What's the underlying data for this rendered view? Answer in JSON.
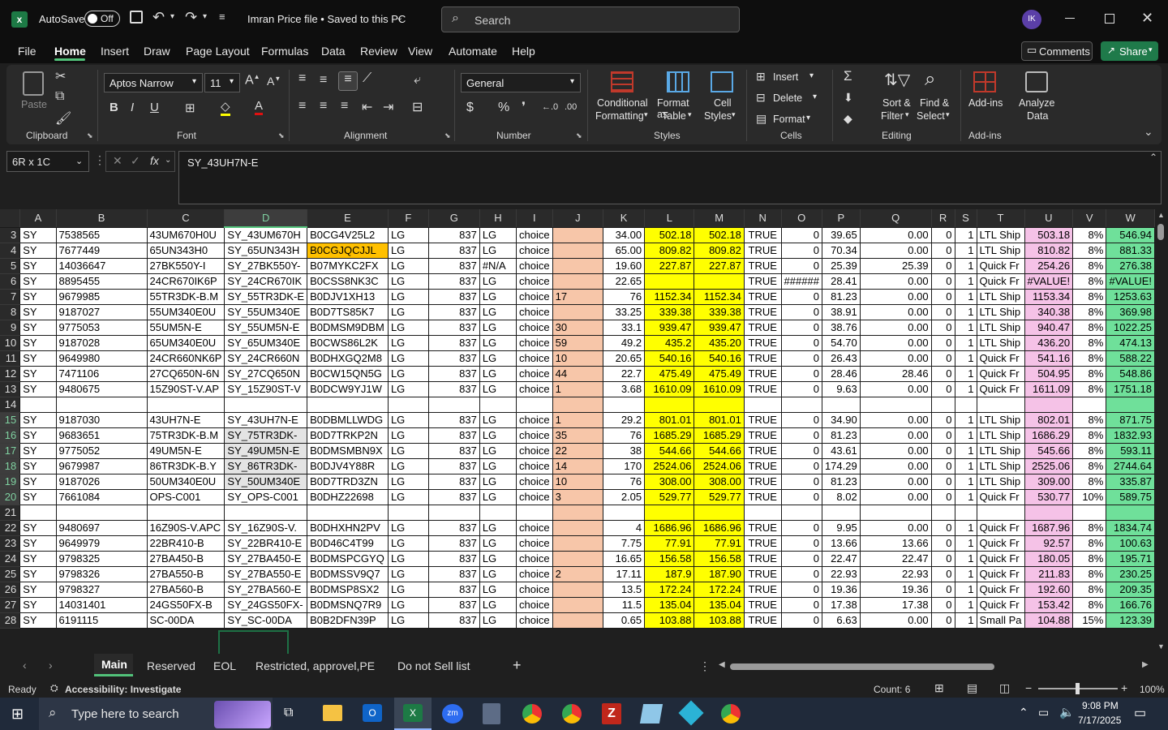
{
  "app": {
    "autosave_label": "AutoSave",
    "autosave_state": "Off",
    "doc_title": "Imran Price file • Saved to this PC",
    "search_placeholder": "Search",
    "avatar_initials": "IK"
  },
  "menu": [
    "File",
    "Home",
    "Insert",
    "Draw",
    "Page Layout",
    "Formulas",
    "Data",
    "Review",
    "View",
    "Automate",
    "Help"
  ],
  "top_buttons": {
    "comments": "Comments",
    "share": "Share"
  },
  "ribbon": {
    "clipboard": {
      "paste": "Paste",
      "group": "Clipboard"
    },
    "font": {
      "name": "Aptos Narrow",
      "size": "11",
      "group": "Font"
    },
    "alignment": {
      "group": "Alignment"
    },
    "number": {
      "format": "General",
      "group": "Number"
    },
    "styles": {
      "conditional": [
        "Conditional",
        "Formatting"
      ],
      "format_table": [
        "Format as",
        "Table"
      ],
      "cell_styles": [
        "Cell",
        "Styles"
      ],
      "group": "Styles"
    },
    "cells": {
      "insert": "Insert",
      "delete": "Delete",
      "format": "Format",
      "group": "Cells"
    },
    "editing": {
      "sort": [
        "Sort &",
        "Filter"
      ],
      "find": [
        "Find &",
        "Select"
      ],
      "group": "Editing"
    },
    "addins": {
      "addins": "Add-ins",
      "analyze": [
        "Analyze",
        "Data"
      ],
      "group": "Add-ins"
    }
  },
  "formula_bar": {
    "name_box": "6R x 1C",
    "content": "SY_43UH7N-E"
  },
  "columns": [
    "A",
    "B",
    "C",
    "D",
    "E",
    "F",
    "G",
    "H",
    "I",
    "J",
    "K",
    "L",
    "M",
    "N",
    "O",
    "P",
    "Q",
    "R",
    "S",
    "T",
    "U",
    "V",
    "W"
  ],
  "rows": [
    {
      "n": "3",
      "c": [
        "SY",
        "7538565",
        "43UM670H0U",
        "SY_43UM670H",
        "B0CG4V25L2",
        "LG",
        "837",
        "LG",
        "choice",
        "",
        "34.00",
        "502.18",
        "502.18",
        "TRUE",
        "0",
        "39.65",
        "0.00",
        "0",
        "1",
        "LTL Ship",
        "503.18",
        "8%",
        "546.94"
      ]
    },
    {
      "n": "4",
      "c": [
        "SY",
        "7677449",
        "65UN343H0",
        "SY_65UN343H",
        "B0CGJQCJJL",
        "LG",
        "837",
        "LG",
        "choice",
        "",
        "65.00",
        "809.82",
        "809.82",
        "TRUE",
        "0",
        "70.34",
        "0.00",
        "0",
        "1",
        "LTL Ship",
        "810.82",
        "8%",
        "881.33"
      ]
    },
    {
      "n": "5",
      "c": [
        "SY",
        "14036647",
        "27BK550Y-I",
        "SY_27BK550Y-",
        "B07MYKC2FX",
        "LG",
        "837",
        "#N/A",
        "choice",
        "",
        "19.60",
        "227.87",
        "227.87",
        "TRUE",
        "0",
        "25.39",
        "25.39",
        "0",
        "1",
        "Quick Fr",
        "254.26",
        "8%",
        "276.38"
      ]
    },
    {
      "n": "6",
      "c": [
        "SY",
        "8895455",
        "24CR670IK6P",
        "SY_24CR670IK",
        "B0CSS8NK3C",
        "LG",
        "837",
        "LG",
        "choice",
        "",
        "22.65",
        "",
        "",
        "TRUE",
        "######",
        "28.41",
        "0.00",
        "0",
        "1",
        "Quick Fr",
        "#VALUE!",
        "8%",
        "#VALUE!"
      ]
    },
    {
      "n": "7",
      "c": [
        "SY",
        "9679985",
        "55TR3DK-B.M",
        "SY_55TR3DK-E",
        "B0DJV1XH13",
        "LG",
        "837",
        "LG",
        "choice",
        "17",
        "76",
        "1152.34",
        "1152.34",
        "TRUE",
        "0",
        "81.23",
        "0.00",
        "0",
        "1",
        "LTL Ship",
        "1153.34",
        "8%",
        "1253.63"
      ]
    },
    {
      "n": "8",
      "c": [
        "SY",
        "9187027",
        "55UM340E0U",
        "SY_55UM340E",
        "B0D7TS85K7",
        "LG",
        "837",
        "LG",
        "choice",
        "",
        "33.25",
        "339.38",
        "339.38",
        "TRUE",
        "0",
        "38.91",
        "0.00",
        "0",
        "1",
        "LTL Ship",
        "340.38",
        "8%",
        "369.98"
      ]
    },
    {
      "n": "9",
      "c": [
        "SY",
        "9775053",
        "55UM5N-E",
        "SY_55UM5N-E",
        "B0DMSM9DBM",
        "LG",
        "837",
        "LG",
        "choice",
        "30",
        "33.1",
        "939.47",
        "939.47",
        "TRUE",
        "0",
        "38.76",
        "0.00",
        "0",
        "1",
        "LTL Ship",
        "940.47",
        "8%",
        "1022.25"
      ]
    },
    {
      "n": "10",
      "c": [
        "SY",
        "9187028",
        "65UM340E0U",
        "SY_65UM340E",
        "B0CWS86L2K",
        "LG",
        "837",
        "LG",
        "choice",
        "59",
        "49.2",
        "435.2",
        "435.20",
        "TRUE",
        "0",
        "54.70",
        "0.00",
        "0",
        "1",
        "LTL Ship",
        "436.20",
        "8%",
        "474.13"
      ]
    },
    {
      "n": "11",
      "c": [
        "SY",
        "9649980",
        "24CR660NK6P",
        "SY_24CR660N",
        "B0DHXGQ2M8",
        "LG",
        "837",
        "LG",
        "choice",
        "10",
        "20.65",
        "540.16",
        "540.16",
        "TRUE",
        "0",
        "26.43",
        "0.00",
        "0",
        "1",
        "Quick Fr",
        "541.16",
        "8%",
        "588.22"
      ]
    },
    {
      "n": "12",
      "c": [
        "SY",
        "7471106",
        "27CQ650N-6N",
        "SY_27CQ650N",
        "B0CW15QN5G",
        "LG",
        "837",
        "LG",
        "choice",
        "44",
        "22.7",
        "475.49",
        "475.49",
        "TRUE",
        "0",
        "28.46",
        "28.46",
        "0",
        "1",
        "Quick Fr",
        "504.95",
        "8%",
        "548.86"
      ]
    },
    {
      "n": "13",
      "c": [
        "SY",
        "9480675",
        "15Z90ST-V.AP",
        "SY_15Z90ST-V",
        "B0DCW9YJ1W",
        "LG",
        "837",
        "LG",
        "choice",
        "1",
        "3.68",
        "1610.09",
        "1610.09",
        "TRUE",
        "0",
        "9.63",
        "0.00",
        "0",
        "1",
        "Quick Fr",
        "1611.09",
        "8%",
        "1751.18"
      ]
    },
    {
      "n": "14",
      "c": [
        "",
        "",
        "",
        "",
        "",
        "",
        "",
        "",
        "",
        "",
        "",
        "",
        "",
        "",
        "",
        "",
        "",
        "",
        "",
        "",
        "",
        "",
        ""
      ]
    },
    {
      "n": "15",
      "c": [
        "SY",
        "9187030",
        "43UH7N-E",
        "SY_43UH7N-E",
        "B0DBMLLWDG",
        "LG",
        "837",
        "LG",
        "choice",
        "1",
        "29.2",
        "801.01",
        "801.01",
        "TRUE",
        "0",
        "34.90",
        "0.00",
        "0",
        "1",
        "LTL Ship",
        "802.01",
        "8%",
        "871.75"
      ]
    },
    {
      "n": "16",
      "c": [
        "SY",
        "9683651",
        "75TR3DK-B.M",
        "SY_75TR3DK-",
        "B0D7TRKP2N",
        "LG",
        "837",
        "LG",
        "choice",
        "35",
        "76",
        "1685.29",
        "1685.29",
        "TRUE",
        "0",
        "81.23",
        "0.00",
        "0",
        "1",
        "LTL Ship",
        "1686.29",
        "8%",
        "1832.93"
      ]
    },
    {
      "n": "17",
      "c": [
        "SY",
        "9775052",
        "49UM5N-E",
        "SY_49UM5N-E",
        "B0DMSMBN9X",
        "LG",
        "837",
        "LG",
        "choice",
        "22",
        "38",
        "544.66",
        "544.66",
        "TRUE",
        "0",
        "43.61",
        "0.00",
        "0",
        "1",
        "LTL Ship",
        "545.66",
        "8%",
        "593.11"
      ]
    },
    {
      "n": "18",
      "c": [
        "SY",
        "9679987",
        "86TR3DK-B.Y",
        "SY_86TR3DK-",
        "B0DJV4Y88R",
        "LG",
        "837",
        "LG",
        "choice",
        "14",
        "170",
        "2524.06",
        "2524.06",
        "TRUE",
        "0",
        "174.29",
        "0.00",
        "0",
        "1",
        "LTL Ship",
        "2525.06",
        "8%",
        "2744.64"
      ]
    },
    {
      "n": "19",
      "c": [
        "SY",
        "9187026",
        "50UM340E0U",
        "SY_50UM340E",
        "B0D7TRD3ZN",
        "LG",
        "837",
        "LG",
        "choice",
        "10",
        "76",
        "308.00",
        "308.00",
        "TRUE",
        "0",
        "81.23",
        "0.00",
        "0",
        "1",
        "LTL Ship",
        "309.00",
        "8%",
        "335.87"
      ]
    },
    {
      "n": "20",
      "c": [
        "SY",
        "7661084",
        "OPS-C001",
        "SY_OPS-C001",
        "B0DHZ22698",
        "LG",
        "837",
        "LG",
        "choice",
        "3",
        "2.05",
        "529.77",
        "529.77",
        "TRUE",
        "0",
        "8.02",
        "0.00",
        "0",
        "1",
        "Quick Fr",
        "530.77",
        "10%",
        "589.75"
      ]
    },
    {
      "n": "21",
      "c": [
        "",
        "",
        "",
        "",
        "",
        "",
        "",
        "",
        "",
        "",
        "",
        "",
        "",
        "",
        "",
        "",
        "",
        "",
        "",
        "",
        "",
        "",
        ""
      ]
    },
    {
      "n": "22",
      "c": [
        "SY",
        "9480697",
        "16Z90S-V.APC",
        "SY_16Z90S-V.",
        "B0DHXHN2PV",
        "LG",
        "837",
        "LG",
        "choice",
        "",
        "4",
        "1686.96",
        "1686.96",
        "TRUE",
        "0",
        "9.95",
        "0.00",
        "0",
        "1",
        "Quick Fr",
        "1687.96",
        "8%",
        "1834.74"
      ]
    },
    {
      "n": "23",
      "c": [
        "SY",
        "9649979",
        "22BR410-B",
        "SY_22BR410-E",
        "B0D46C4T99",
        "LG",
        "837",
        "LG",
        "choice",
        "",
        "7.75",
        "77.91",
        "77.91",
        "TRUE",
        "0",
        "13.66",
        "13.66",
        "0",
        "1",
        "Quick Fr",
        "92.57",
        "8%",
        "100.63"
      ]
    },
    {
      "n": "24",
      "c": [
        "SY",
        "9798325",
        "27BA450-B",
        "SY_27BA450-E",
        "B0DMSPCGYQ",
        "LG",
        "837",
        "LG",
        "choice",
        "",
        "16.65",
        "156.58",
        "156.58",
        "TRUE",
        "0",
        "22.47",
        "22.47",
        "0",
        "1",
        "Quick Fr",
        "180.05",
        "8%",
        "195.71"
      ]
    },
    {
      "n": "25",
      "c": [
        "SY",
        "9798326",
        "27BA550-B",
        "SY_27BA550-E",
        "B0DMSSV9Q7",
        "LG",
        "837",
        "LG",
        "choice",
        "2",
        "17.11",
        "187.9",
        "187.90",
        "TRUE",
        "0",
        "22.93",
        "22.93",
        "0",
        "1",
        "Quick Fr",
        "211.83",
        "8%",
        "230.25"
      ]
    },
    {
      "n": "26",
      "c": [
        "SY",
        "9798327",
        "27BA560-B",
        "SY_27BA560-E",
        "B0DMSP8SX2",
        "LG",
        "837",
        "LG",
        "choice",
        "",
        "13.5",
        "172.24",
        "172.24",
        "TRUE",
        "0",
        "19.36",
        "19.36",
        "0",
        "1",
        "Quick Fr",
        "192.60",
        "8%",
        "209.35"
      ]
    },
    {
      "n": "27",
      "c": [
        "SY",
        "14031401",
        "24GS50FX-B",
        "SY_24GS50FX-",
        "B0DMSNQ7R9",
        "LG",
        "837",
        "LG",
        "choice",
        "",
        "11.5",
        "135.04",
        "135.04",
        "TRUE",
        "0",
        "17.38",
        "17.38",
        "0",
        "1",
        "Quick Fr",
        "153.42",
        "8%",
        "166.76"
      ]
    },
    {
      "n": "28",
      "c": [
        "SY",
        "6191115",
        "SC-00DA",
        "SY_SC-00DA",
        "B0B2DFN39P",
        "LG",
        "837",
        "LG",
        "choice",
        "",
        "0.65",
        "103.88",
        "103.88",
        "TRUE",
        "0",
        "6.63",
        "0.00",
        "0",
        "1",
        "Small Pa",
        "104.88",
        "15%",
        "123.39"
      ]
    }
  ],
  "sheets": [
    "Main",
    "Reserved",
    "EOL",
    "Restricted, approvel,PE",
    "Do not Sell list"
  ],
  "status": {
    "ready": "Ready",
    "accessibility": "Accessibility: Investigate",
    "count": "Count: 6",
    "zoom": "100%"
  },
  "taskbar": {
    "search_placeholder": "Type here to search",
    "time": "9:08 PM",
    "date": "7/17/2025"
  }
}
